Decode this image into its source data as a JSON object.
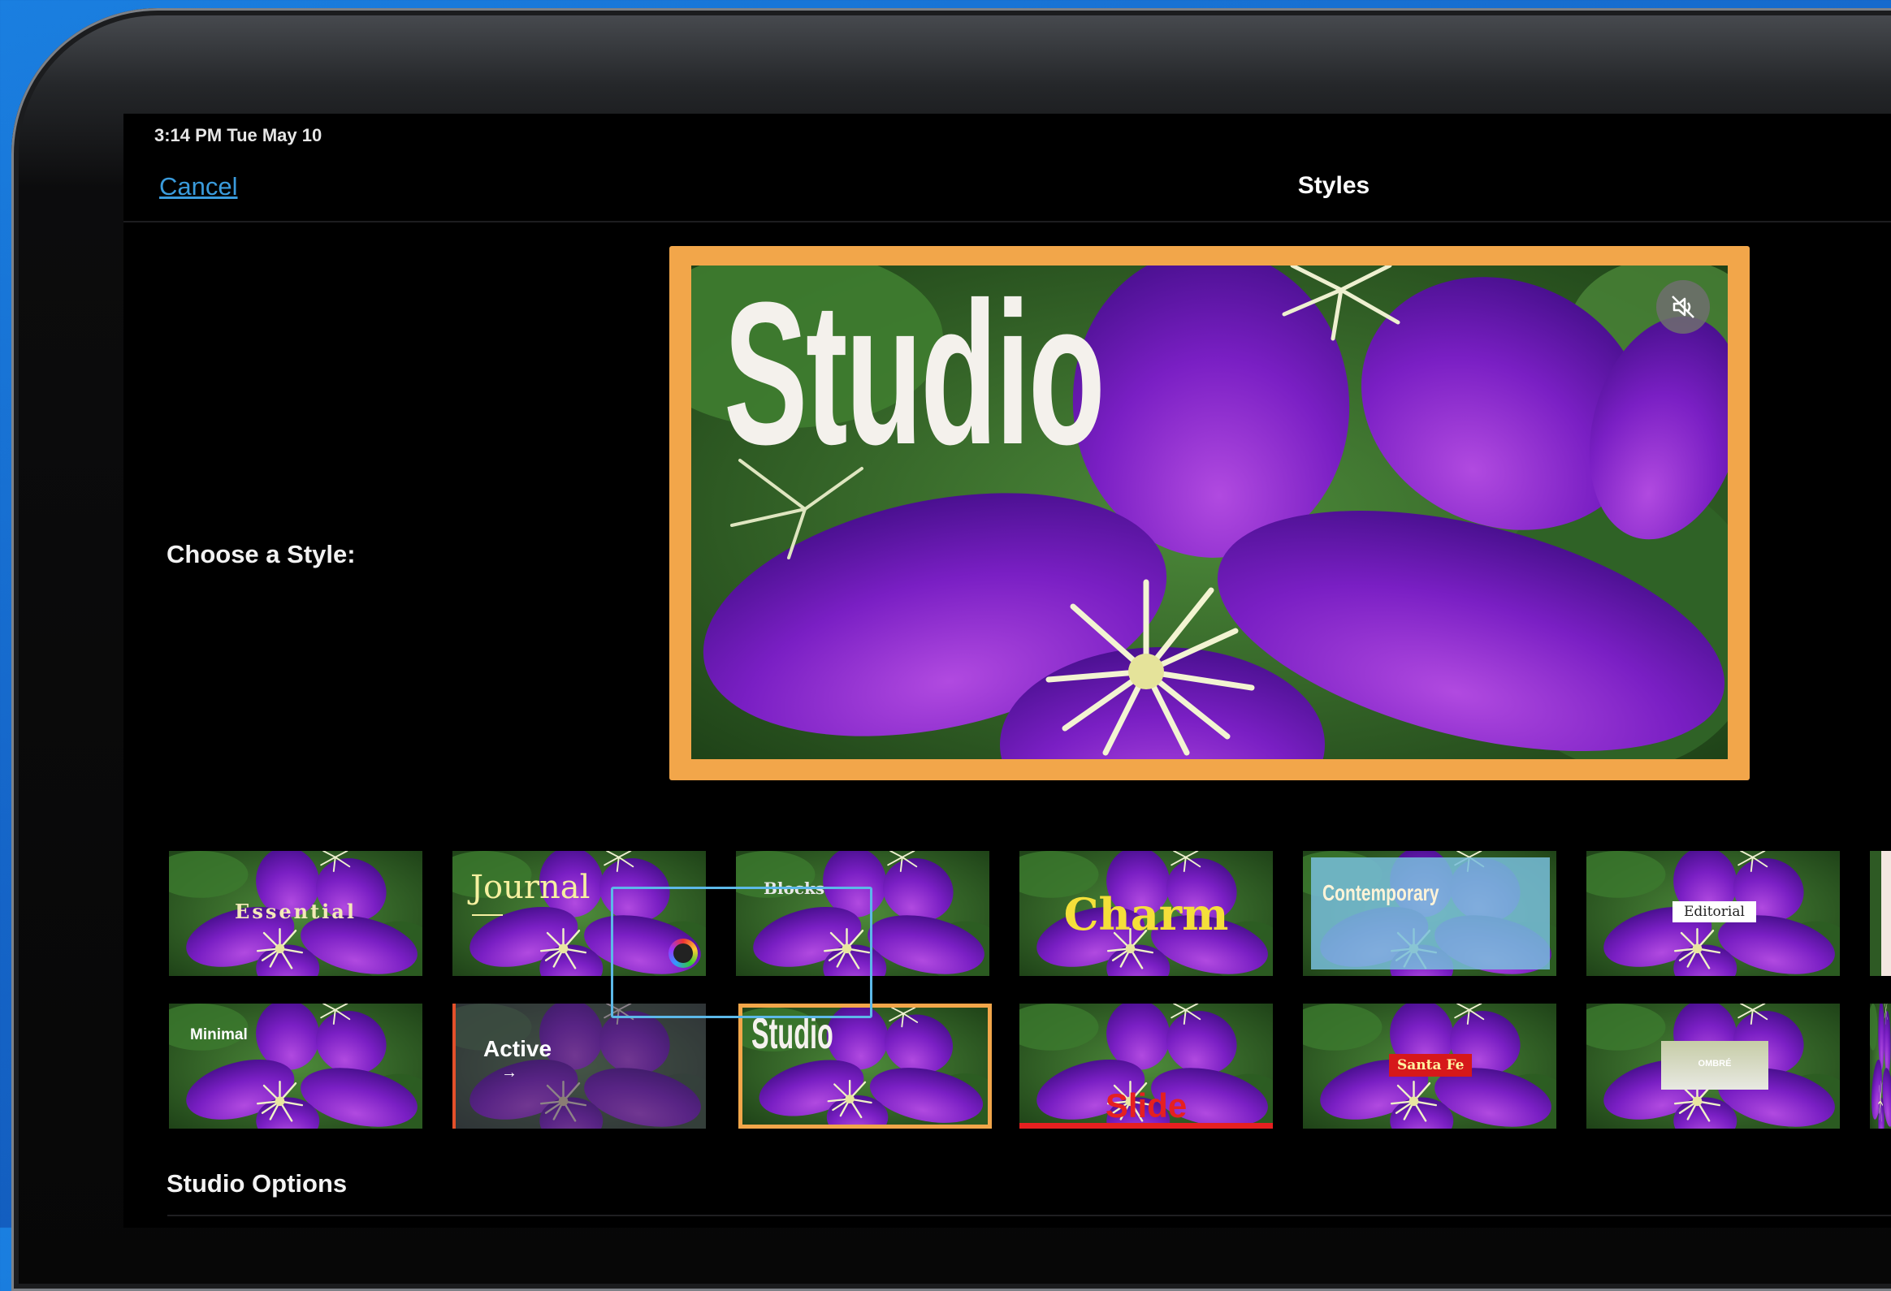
{
  "status_bar": {
    "time_date": "3:14 PM   Tue May 10"
  },
  "nav": {
    "cancel_label": "Cancel",
    "title": "Styles"
  },
  "preview": {
    "title_text": "Studio",
    "mute_icon": "speaker-muted-icon",
    "frame_color": "#f2a64a"
  },
  "choose_label": "Choose a Style:",
  "styles_row1": [
    {
      "label": "Essential"
    },
    {
      "label": "Journal"
    },
    {
      "label": "Blocks"
    },
    {
      "label": "Charm"
    },
    {
      "label": "Contemporary"
    },
    {
      "label": "Editorial"
    }
  ],
  "styles_row2": [
    {
      "label": "Minimal"
    },
    {
      "label": "Active"
    },
    {
      "label": "Studio"
    },
    {
      "label": "Slide"
    },
    {
      "label": "Santa Fe"
    },
    {
      "label": "OMBRÉ"
    }
  ],
  "selected_style": "Studio",
  "options_label": "Studio Options",
  "colors": {
    "accent_link": "#3a9bdc",
    "selection": "#5cb8e8"
  }
}
